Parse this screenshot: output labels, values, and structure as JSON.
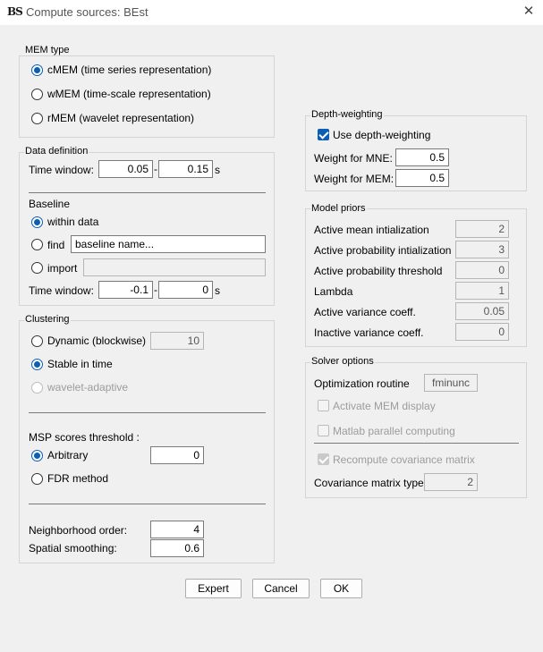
{
  "window": {
    "title": "Compute sources: BEst",
    "app_icon": "BS"
  },
  "mem_type": {
    "label": "MEM type",
    "options": [
      {
        "label": "cMEM   (time series representation)",
        "selected": true
      },
      {
        "label": "wMEM  (time-scale representation)",
        "selected": false
      },
      {
        "label": "rMEM   (wavelet representation)",
        "selected": false
      }
    ]
  },
  "data_definition": {
    "label": "Data definition",
    "time_window_label": "Time window:",
    "time_start": "0.05",
    "time_end": "0.15",
    "range_sep": "-",
    "unit": "s",
    "baseline": {
      "label": "Baseline",
      "within_label": "within data",
      "find_label": "find",
      "find_value": "baseline name...",
      "import_label": "import",
      "import_value": "",
      "time_window_label": "Time window:",
      "time_start": "-0.1",
      "time_end": "0",
      "unit": "s"
    }
  },
  "clustering": {
    "label": "Clustering",
    "dynamic_label": "Dynamic (blockwise)",
    "dynamic_value": "10",
    "stable_label": "Stable in time",
    "wavelet_label": "wavelet-adaptive",
    "msp_label": "MSP scores threshold :",
    "arbitrary_label": "Arbitrary",
    "arbitrary_value": "0",
    "fdr_label": "FDR method",
    "neighborhood_label": "Neighborhood order:",
    "neighborhood_value": "4",
    "smoothing_label": "Spatial smoothing:",
    "smoothing_value": "0.6"
  },
  "depth_weighting": {
    "label": "Depth-weighting",
    "use_label": "Use depth-weighting",
    "mne_label": "Weight for MNE:",
    "mne_value": "0.5",
    "mem_label": "Weight for MEM:",
    "mem_value": "0.5"
  },
  "model_priors": {
    "label": "Model priors",
    "rows": [
      {
        "label": "Active mean intialization",
        "value": "2"
      },
      {
        "label": "Active probability intialization",
        "value": "3"
      },
      {
        "label": "Active probability threshold",
        "value": "0"
      },
      {
        "label": "Lambda",
        "value": "1"
      },
      {
        "label": "Active variance coeff.",
        "value": "0.05"
      },
      {
        "label": "Inactive variance coeff.",
        "value": "0"
      }
    ]
  },
  "solver": {
    "label": "Solver options",
    "routine_label": "Optimization routine",
    "routine_value": "fminunc",
    "mem_display_label": "Activate MEM display",
    "parallel_label": "Matlab parallel computing",
    "recompute_label": "Recompute covariance matrix",
    "cov_type_label": "Covariance matrix type",
    "cov_type_value": "2"
  },
  "buttons": {
    "expert": "Expert",
    "cancel": "Cancel",
    "ok": "OK"
  },
  "colors": {
    "accent": "#0a5fb4",
    "background": "#f0f0f0"
  }
}
